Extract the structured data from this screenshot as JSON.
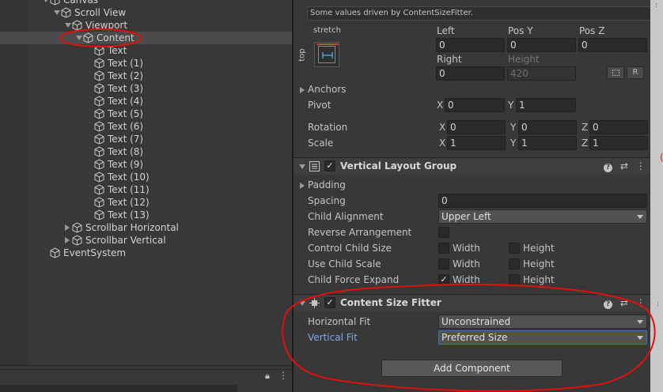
{
  "hierarchy": {
    "items": [
      {
        "label": "Canvas",
        "depth": 0,
        "expand": "down"
      },
      {
        "label": "Scroll View",
        "depth": 1,
        "expand": "down"
      },
      {
        "label": "Viewport",
        "depth": 2,
        "expand": "down"
      },
      {
        "label": "Content",
        "depth": 3,
        "expand": "down",
        "selected": true
      },
      {
        "label": "Text",
        "depth": 4,
        "expand": "none"
      },
      {
        "label": "Text (1)",
        "depth": 4,
        "expand": "none"
      },
      {
        "label": "Text (2)",
        "depth": 4,
        "expand": "none"
      },
      {
        "label": "Text (3)",
        "depth": 4,
        "expand": "none"
      },
      {
        "label": "Text (4)",
        "depth": 4,
        "expand": "none"
      },
      {
        "label": "Text (5)",
        "depth": 4,
        "expand": "none"
      },
      {
        "label": "Text (6)",
        "depth": 4,
        "expand": "none"
      },
      {
        "label": "Text (7)",
        "depth": 4,
        "expand": "none"
      },
      {
        "label": "Text (8)",
        "depth": 4,
        "expand": "none"
      },
      {
        "label": "Text (9)",
        "depth": 4,
        "expand": "none"
      },
      {
        "label": "Text (10)",
        "depth": 4,
        "expand": "none"
      },
      {
        "label": "Text (11)",
        "depth": 4,
        "expand": "none"
      },
      {
        "label": "Text (12)",
        "depth": 4,
        "expand": "none"
      },
      {
        "label": "Text (13)",
        "depth": 4,
        "expand": "none"
      },
      {
        "label": "Scrollbar Horizontal",
        "depth": 2,
        "expand": "right"
      },
      {
        "label": "Scrollbar Vertical",
        "depth": 2,
        "expand": "right"
      },
      {
        "label": "EventSystem",
        "depth": 0,
        "expand": "none"
      }
    ]
  },
  "rect_transform": {
    "notice": "Some values driven by ContentSizeFitter.",
    "anchor_preset_top": "stretch",
    "anchor_preset_side": "top",
    "left_label": "Left",
    "left_value": "0",
    "posy_label": "Pos Y",
    "posy_value": "0",
    "posz_label": "Pos Z",
    "posz_value": "0",
    "right_label": "Right",
    "right_value": "0",
    "height_label": "Height",
    "height_value": "420",
    "raw_button": "R",
    "anchors_label": "Anchors",
    "pivot_label": "Pivot",
    "pivot_x": "0",
    "pivot_y": "1",
    "rotation_label": "Rotation",
    "rot_x": "0",
    "rot_y": "0",
    "rot_z": "0",
    "scale_label": "Scale",
    "scale_x": "1",
    "scale_y": "1",
    "scale_z": "1",
    "axis_x": "X",
    "axis_y": "Y",
    "axis_z": "Z"
  },
  "vertical_layout_group": {
    "title": "Vertical Layout Group",
    "padding_label": "Padding",
    "spacing_label": "Spacing",
    "spacing_value": "0",
    "child_alignment_label": "Child Alignment",
    "child_alignment_value": "Upper Left",
    "reverse_label": "Reverse Arrangement",
    "control_child_size_label": "Control Child Size",
    "use_child_scale_label": "Use Child Scale",
    "child_force_expand_label": "Child Force Expand",
    "width_label": "Width",
    "height_label": "Height"
  },
  "content_size_fitter": {
    "title": "Content Size Fitter",
    "horizontal_fit_label": "Horizontal Fit",
    "horizontal_fit_value": "Unconstrained",
    "vertical_fit_label": "Vertical Fit",
    "vertical_fit_value": "Preferred Size"
  },
  "add_component_label": "Add Component",
  "annotation_color": "#e01010",
  "help_glyph": "?",
  "check_glyph": "✓",
  "presets_glyph": "⇄",
  "menu_glyph": "⋮",
  "lock_glyph": "🔒"
}
